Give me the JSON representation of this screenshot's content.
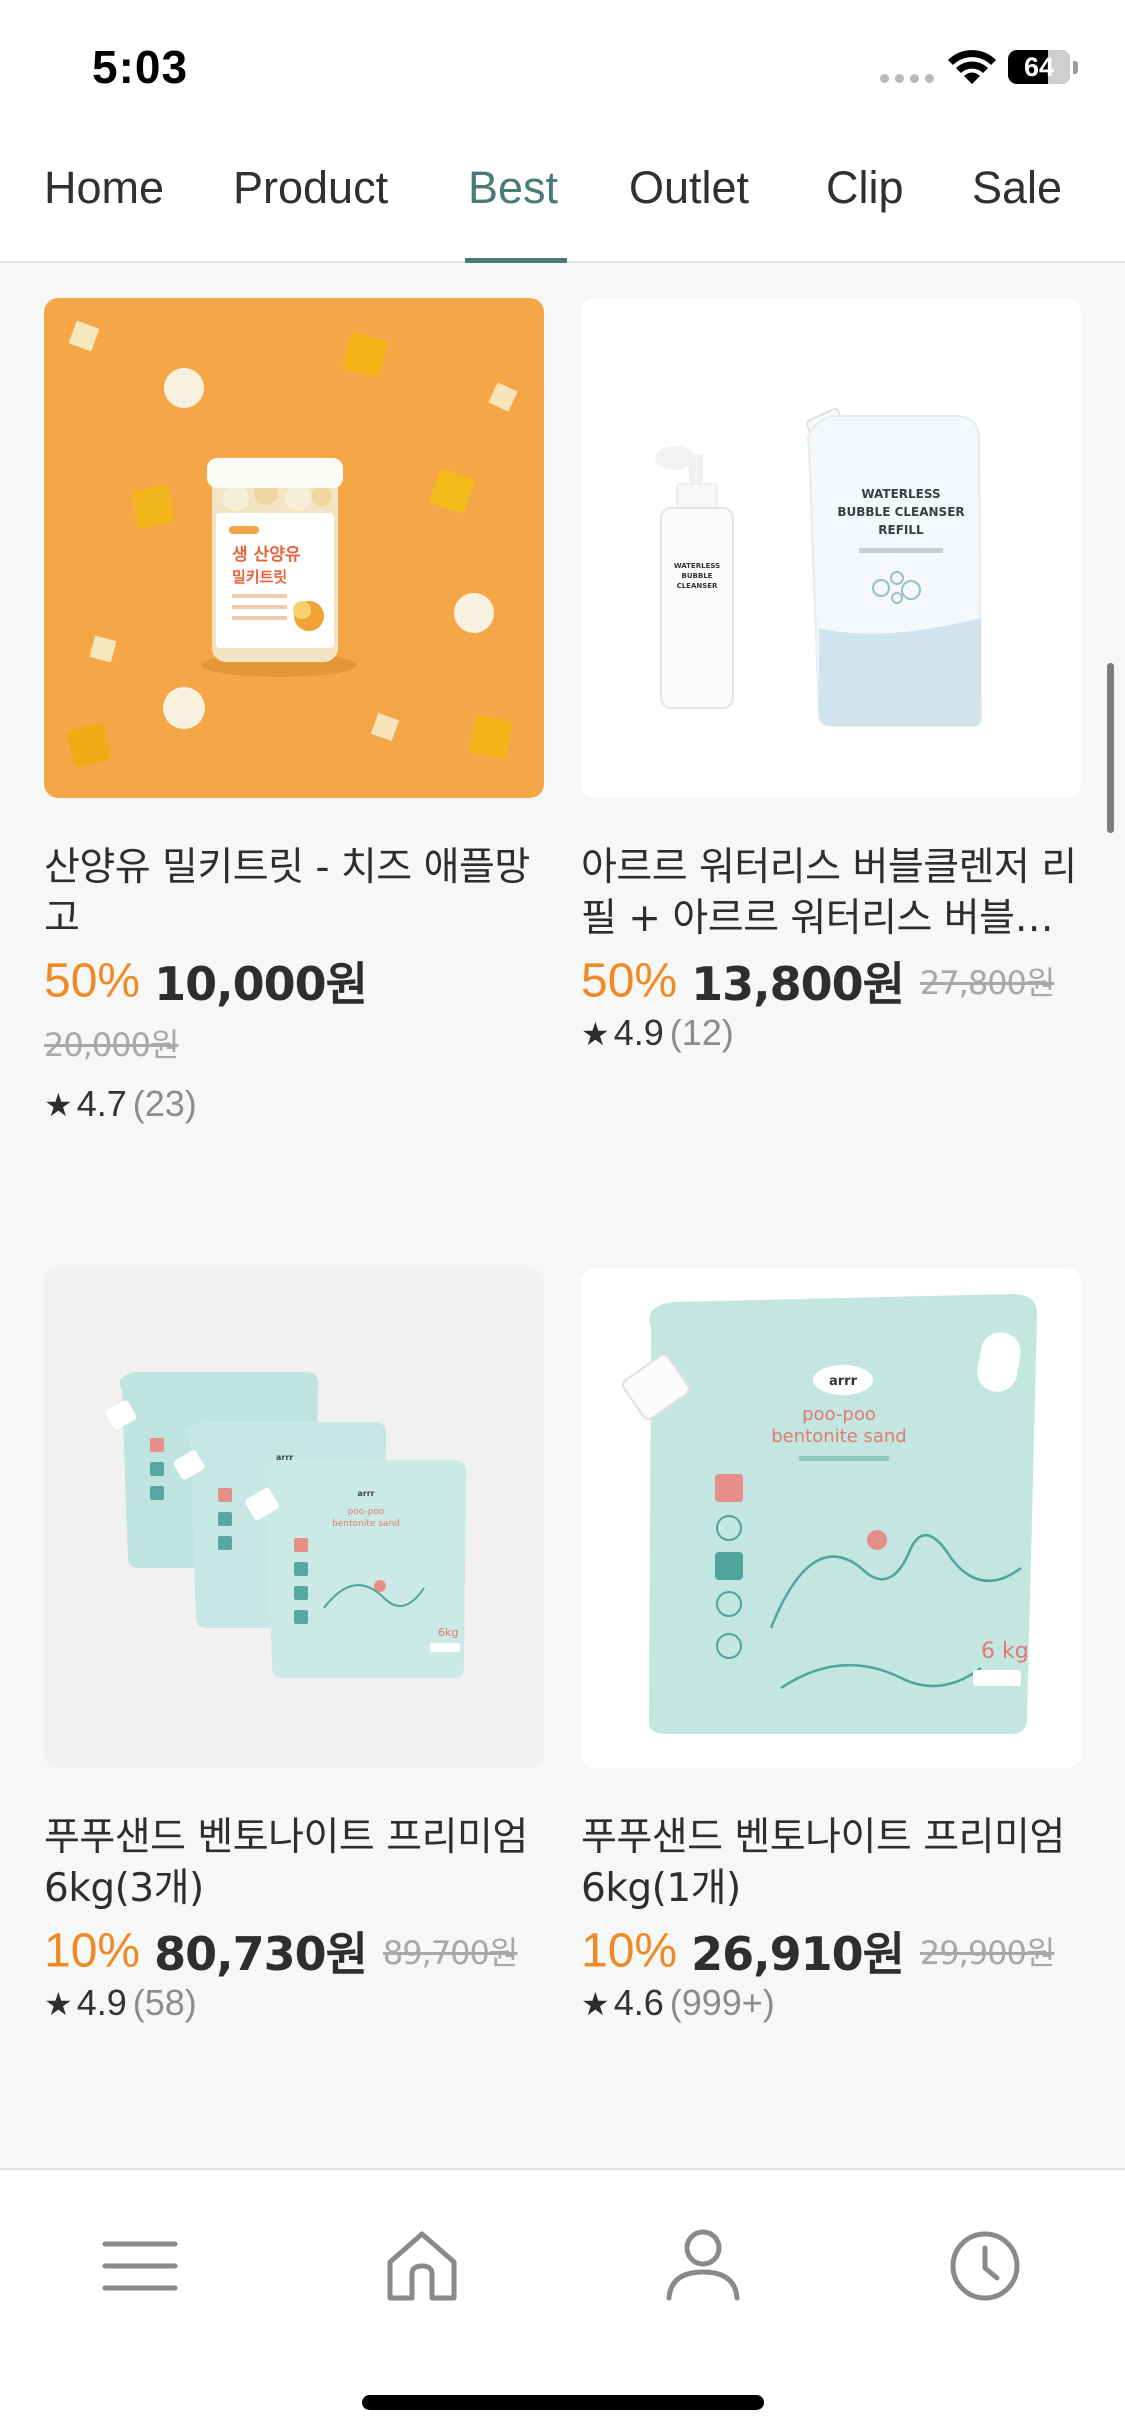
{
  "status_bar": {
    "time": "5:03",
    "battery": "64"
  },
  "tabs": [
    {
      "label": "Home"
    },
    {
      "label": "Product"
    },
    {
      "label": "Best",
      "active": true
    },
    {
      "label": "Outlet"
    },
    {
      "label": "Clip"
    },
    {
      "label": "Sale"
    }
  ],
  "products": [
    {
      "title": "산양유 밀키트릿 - 치즈 애플망고",
      "discount": "50%",
      "price": "10,000원",
      "original_price": "20,000원",
      "rating": "4.7",
      "reviews": "(23)",
      "image_icon": "goat-milk-treat-jar-image"
    },
    {
      "title": "아르르 워터리스 버블클렌저 리필 + 아르르 워터리스 버블클렌저",
      "discount": "50%",
      "price": "13,800원",
      "original_price": "27,800원",
      "rating": "4.9",
      "reviews": "(12)",
      "image_icon": "bubble-cleanser-refill-image",
      "image_text": {
        "refill": [
          "WATERLESS",
          "BUBBLE CLEANSER",
          "REFILL"
        ],
        "bottle": [
          "WATERLESS",
          "BUBBLE",
          "CLEANSER"
        ]
      }
    },
    {
      "title": "푸푸샌드 벤토나이트 프리미엄 6kg(3개)",
      "discount": "10%",
      "price": "80,730원",
      "original_price": "89,700원",
      "rating": "4.9",
      "reviews": "(58)",
      "image_icon": "bentonite-sand-bags-image"
    },
    {
      "title": "푸푸샌드 벤토나이트 프리미엄 6kg(1개)",
      "discount": "10%",
      "price": "26,910원",
      "original_price": "29,900원",
      "rating": "4.6",
      "reviews": "(999+)",
      "image_icon": "bentonite-sand-bag-image",
      "image_text": {
        "brand": "arrr",
        "line1": "poo-poo",
        "line2": "bentonite sand",
        "weight": "6 kg"
      }
    }
  ],
  "bottom_nav": [
    {
      "icon": "menu-icon"
    },
    {
      "icon": "home-icon"
    },
    {
      "icon": "profile-icon"
    },
    {
      "icon": "clock-icon"
    }
  ],
  "colors": {
    "accent": "#4a7b7b",
    "discount": "#f08a24",
    "background": "#f6f7f7"
  }
}
